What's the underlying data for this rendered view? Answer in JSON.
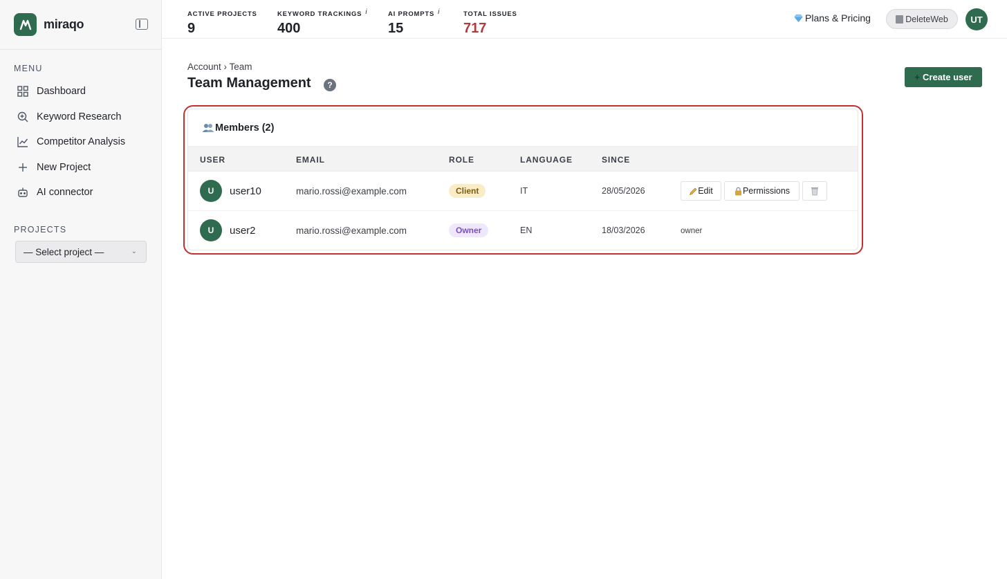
{
  "app": {
    "brand": "miraqo"
  },
  "sidebar": {
    "menu_label": "MENU",
    "items": [
      {
        "label": "Dashboard",
        "icon": "grid-icon"
      },
      {
        "label": "Keyword Research",
        "icon": "search-plus-icon"
      },
      {
        "label": "Competitor Analysis",
        "icon": "line-chart-icon"
      },
      {
        "label": "New Project",
        "icon": "plus-icon"
      },
      {
        "label": "AI connector",
        "icon": "robot-icon"
      }
    ],
    "projects_label": "PROJECTS",
    "project_select": "— Select project —"
  },
  "stats": [
    {
      "label": "ACTIVE PROJECTS",
      "value": "9",
      "info": ""
    },
    {
      "label": "KEYWORD TRACKINGS",
      "value": "400",
      "info": "i"
    },
    {
      "label": "AI PROMPTS",
      "value": "15",
      "info": "i"
    },
    {
      "label": "TOTAL ISSUES",
      "value": "717",
      "info": ""
    }
  ],
  "header": {
    "plans_label": "Plans & Pricing",
    "org_label": "DeleteWeb",
    "user_initials": "UT"
  },
  "page": {
    "breadcrumb": "Account › Team",
    "title": "Team Management",
    "help": "?",
    "create_label": "Create user",
    "create_plus": "+"
  },
  "members": {
    "title": "Members (2)",
    "columns": [
      "USER",
      "EMAIL",
      "ROLE",
      "LANGUAGE",
      "SINCE"
    ],
    "rows": [
      {
        "initial": "U",
        "username": "user10",
        "email": "mario.rossi@example.com",
        "role": "Client",
        "language": "IT",
        "since": "28/05/2026",
        "edit": "Edit",
        "permissions": "Permissions"
      },
      {
        "initial": "U",
        "username": "user2",
        "email": "mario.rossi@example.com",
        "role": "Owner",
        "language": "EN",
        "since": "18/03/2026",
        "note": "owner"
      }
    ]
  },
  "colors": {
    "brand": "#2f6b4f",
    "danger": "#b23a3a",
    "highlight": "#c62f2f"
  }
}
